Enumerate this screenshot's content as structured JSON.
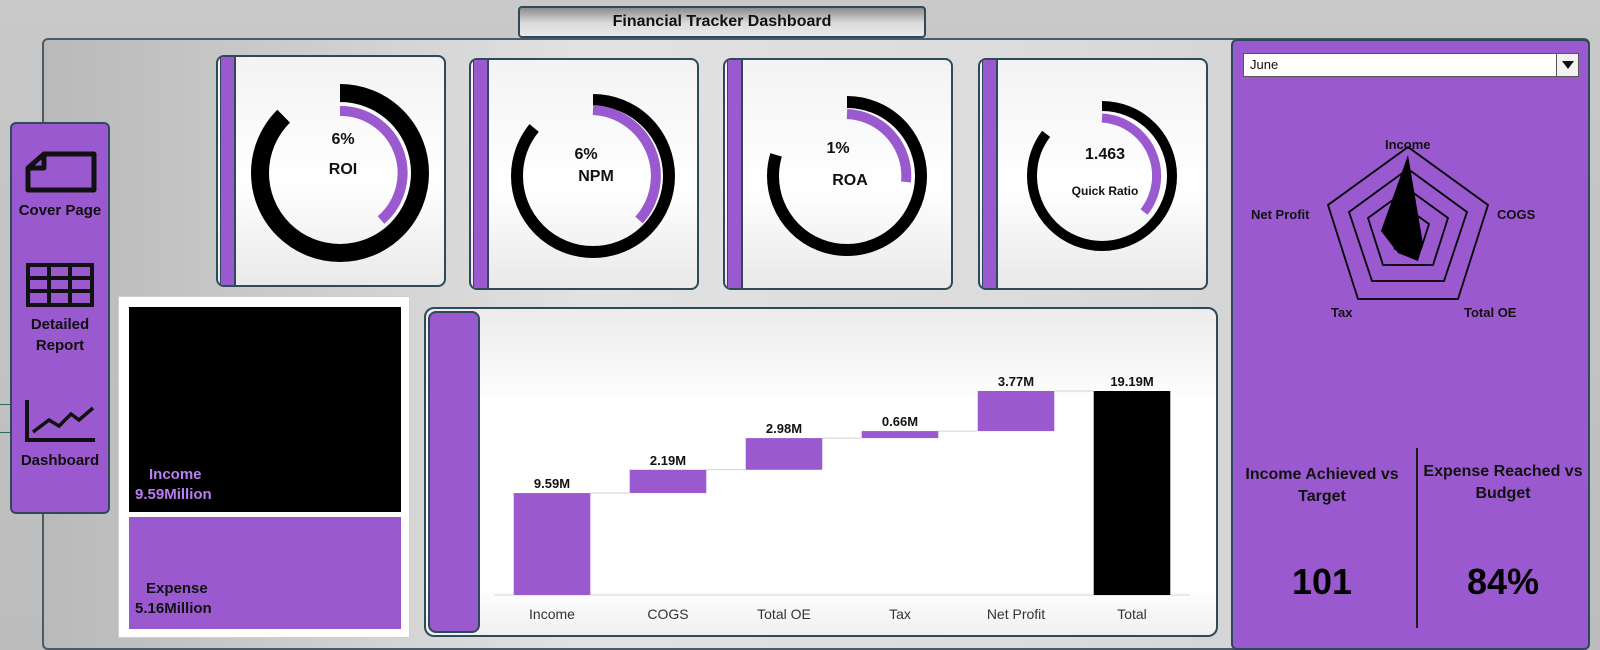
{
  "title": "Financial Tracker Dashboard",
  "colors": {
    "accent": "#9b59d0",
    "dark": "#000000",
    "border": "#2e4a5a"
  },
  "nav": {
    "items": [
      {
        "label": "Cover Page",
        "icon": "folder-icon"
      },
      {
        "label": "Detailed Report",
        "icon": "table-icon"
      },
      {
        "label": "Dashboard",
        "icon": "line-chart-icon"
      }
    ]
  },
  "kpis": [
    {
      "value": "6%",
      "label": "ROI",
      "fraction": 0.06
    },
    {
      "value": "6%",
      "label": "NPM",
      "fraction": 0.06
    },
    {
      "value": "1%",
      "label": "ROA",
      "fraction": 0.01
    },
    {
      "value": "1.463",
      "label": "Quick Ratio"
    }
  ],
  "treemap": {
    "income": {
      "label": "Income",
      "value": "9.59Million"
    },
    "expense": {
      "label": "Expense",
      "value": "5.16Million"
    }
  },
  "filter": {
    "month": "June"
  },
  "radar": {
    "axes": [
      "Income",
      "COGS",
      "Total OE",
      "Tax",
      "Net Profit"
    ]
  },
  "metrics": [
    {
      "title": "Income Achieved vs Target",
      "value": "101"
    },
    {
      "title": "Expense Reached vs Budget",
      "value": "84%"
    }
  ],
  "chart_data": {
    "type": "bar",
    "categories": [
      "Income",
      "COGS",
      "Total OE",
      "Tax",
      "Net Profit",
      "Total"
    ],
    "values": [
      9.59,
      2.19,
      2.98,
      0.66,
      3.77,
      19.19
    ],
    "data_labels": [
      "9.59M",
      "2.19M",
      "2.98M",
      "0.66M",
      "3.77M",
      "19.19M"
    ],
    "ylim": [
      0,
      19.19
    ],
    "grid": false
  }
}
